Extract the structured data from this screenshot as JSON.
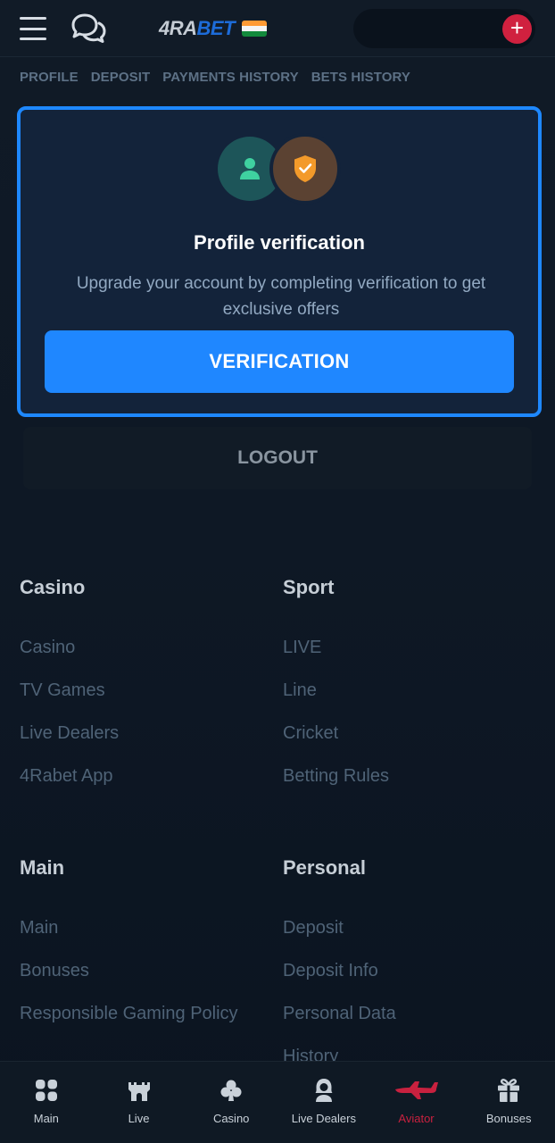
{
  "header": {
    "logo_main": "4RA",
    "logo_accent": "BET",
    "colors": {
      "accent_blue": "#1f87ff",
      "plus_red": "#d0213f"
    }
  },
  "subnav": [
    "PROFILE",
    "DEPOSIT",
    "PAYMENTS HISTORY",
    "BETS HISTORY"
  ],
  "verification": {
    "title": "Profile verification",
    "description": "Upgrade your account by completing verification to get exclusive offers",
    "button": "VERIFICATION"
  },
  "logout_label": "LOGOUT",
  "footer": {
    "casino": {
      "heading": "Casino",
      "links": [
        "Casino",
        "TV Games",
        "Live Dealers",
        "4Rabet App"
      ]
    },
    "sport": {
      "heading": "Sport",
      "links": [
        "LIVE",
        "Line",
        "Cricket",
        "Betting Rules"
      ]
    },
    "main": {
      "heading": "Main",
      "links": [
        "Main",
        "Bonuses",
        "Responsible Gaming Policy"
      ]
    },
    "personal": {
      "heading": "Personal",
      "links": [
        "Deposit",
        "Deposit Info",
        "Personal Data",
        "History"
      ]
    }
  },
  "bottom_nav": [
    {
      "label": "Main",
      "icon": "grid-icon"
    },
    {
      "label": "Live",
      "icon": "castle-icon"
    },
    {
      "label": "Casino",
      "icon": "club-icon"
    },
    {
      "label": "Live Dealers",
      "icon": "dealer-icon"
    },
    {
      "label": "Aviator",
      "icon": "plane-icon",
      "active": true
    },
    {
      "label": "Bonuses",
      "icon": "gift-icon"
    }
  ]
}
